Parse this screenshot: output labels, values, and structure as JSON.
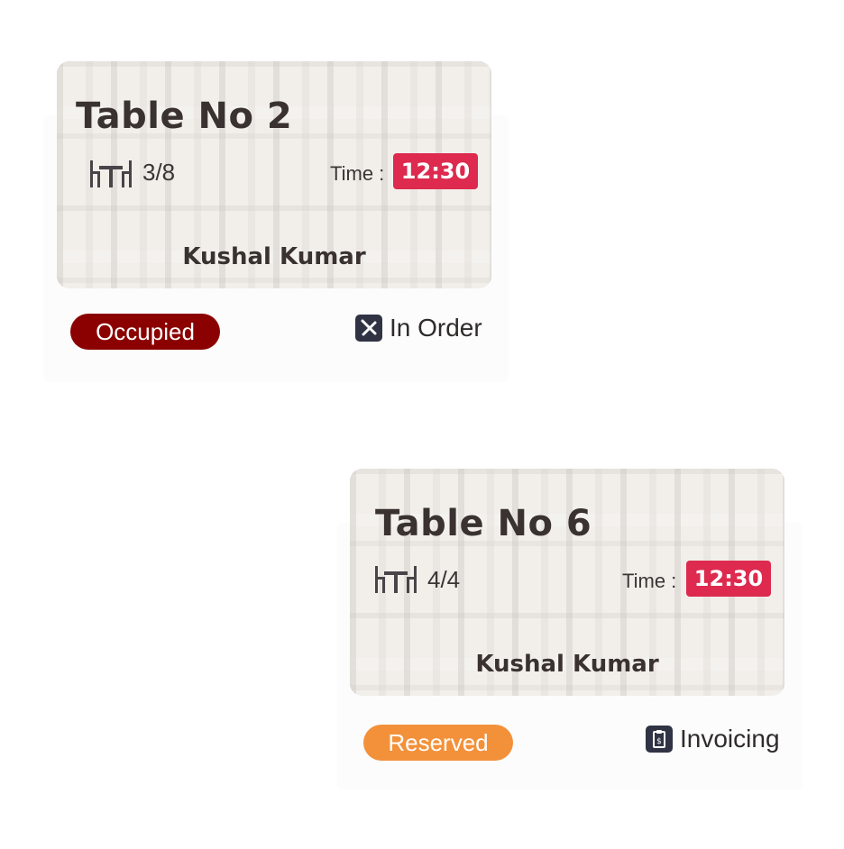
{
  "tables": [
    {
      "title": "Table No 2",
      "seats": "3/8",
      "time_label": "Time :",
      "time": "12:30",
      "customer": "Kushal Kumar",
      "status": "Occupied",
      "status_color": "#8b0000",
      "state": "In Order",
      "state_icon": "utensils-icon"
    },
    {
      "title": "Table No 6",
      "seats": "4/4",
      "time_label": "Time :",
      "time": "12:30",
      "customer": "Kushal Kumar",
      "status": "Reserved",
      "status_color": "#f3913a",
      "state": "Invoicing",
      "state_icon": "invoice-icon"
    }
  ],
  "colors": {
    "time_badge": "#dd2a4e",
    "title_text": "#3a3230"
  }
}
